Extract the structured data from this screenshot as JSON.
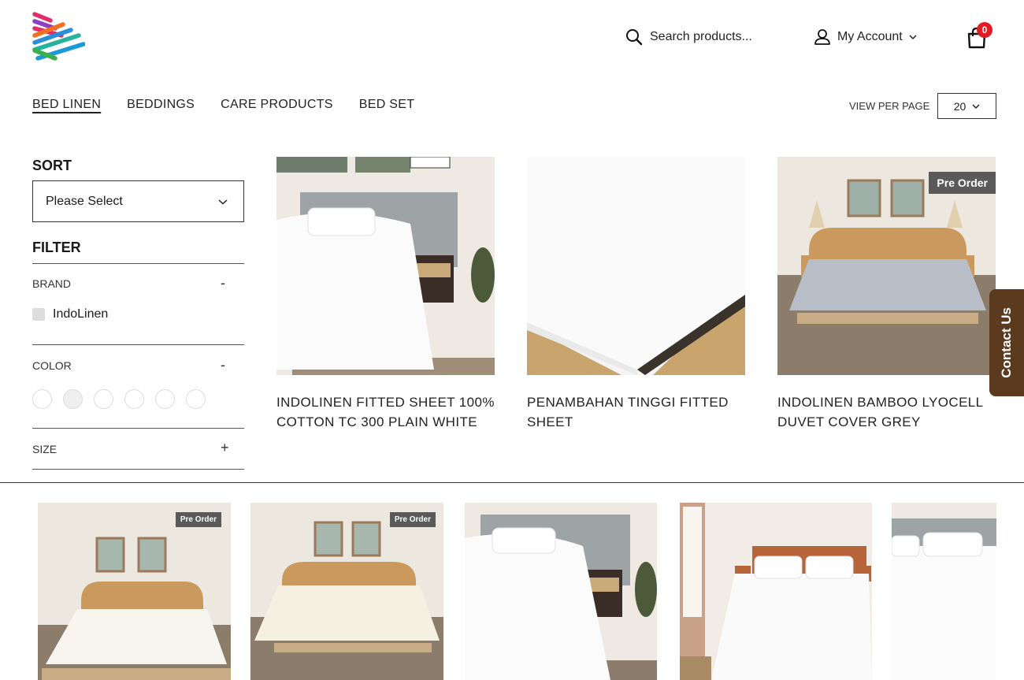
{
  "header": {
    "search_label": "Search products...",
    "account_label": "My Account",
    "cart_count": "0"
  },
  "nav": {
    "categories": [
      "BED LINEN",
      "BEDDINGS",
      "CARE PRODUCTS",
      "BED SET"
    ],
    "active": "BED LINEN",
    "view_per_page_label": "VIEW PER PAGE",
    "view_per_page_value": "20"
  },
  "sidebar": {
    "sort_title": "SORT",
    "sort_value": "Please Select",
    "filter_title": "FILTER",
    "brand_title": "BRAND",
    "brand_toggle": "-",
    "brand_items": [
      "IndoLinen"
    ],
    "color_title": "COLOR",
    "color_toggle": "-",
    "size_title": "SIZE",
    "size_toggle": "+"
  },
  "products": [
    {
      "name": "INDOLINEN FITTED SHEET 100% COTTON TC 300 PLAIN WHITE",
      "badge": ""
    },
    {
      "name": "PENAMBAHAN TINGGI FITTED SHEET",
      "badge": ""
    },
    {
      "name": "INDOLINEN BAMBOO LYOCELL DUVET COVER GREY",
      "badge": "Pre Order"
    }
  ],
  "thumbs": [
    {
      "badge": "Pre Order"
    },
    {
      "badge": "Pre Order"
    },
    {
      "badge": ""
    },
    {
      "badge": ""
    },
    {
      "badge": ""
    }
  ],
  "contact_label": "Contact Us",
  "colors": {
    "cart_badge": "#e31b23",
    "contact_bg": "#5b3a1e",
    "badge_bg": "#5a5a5a"
  }
}
